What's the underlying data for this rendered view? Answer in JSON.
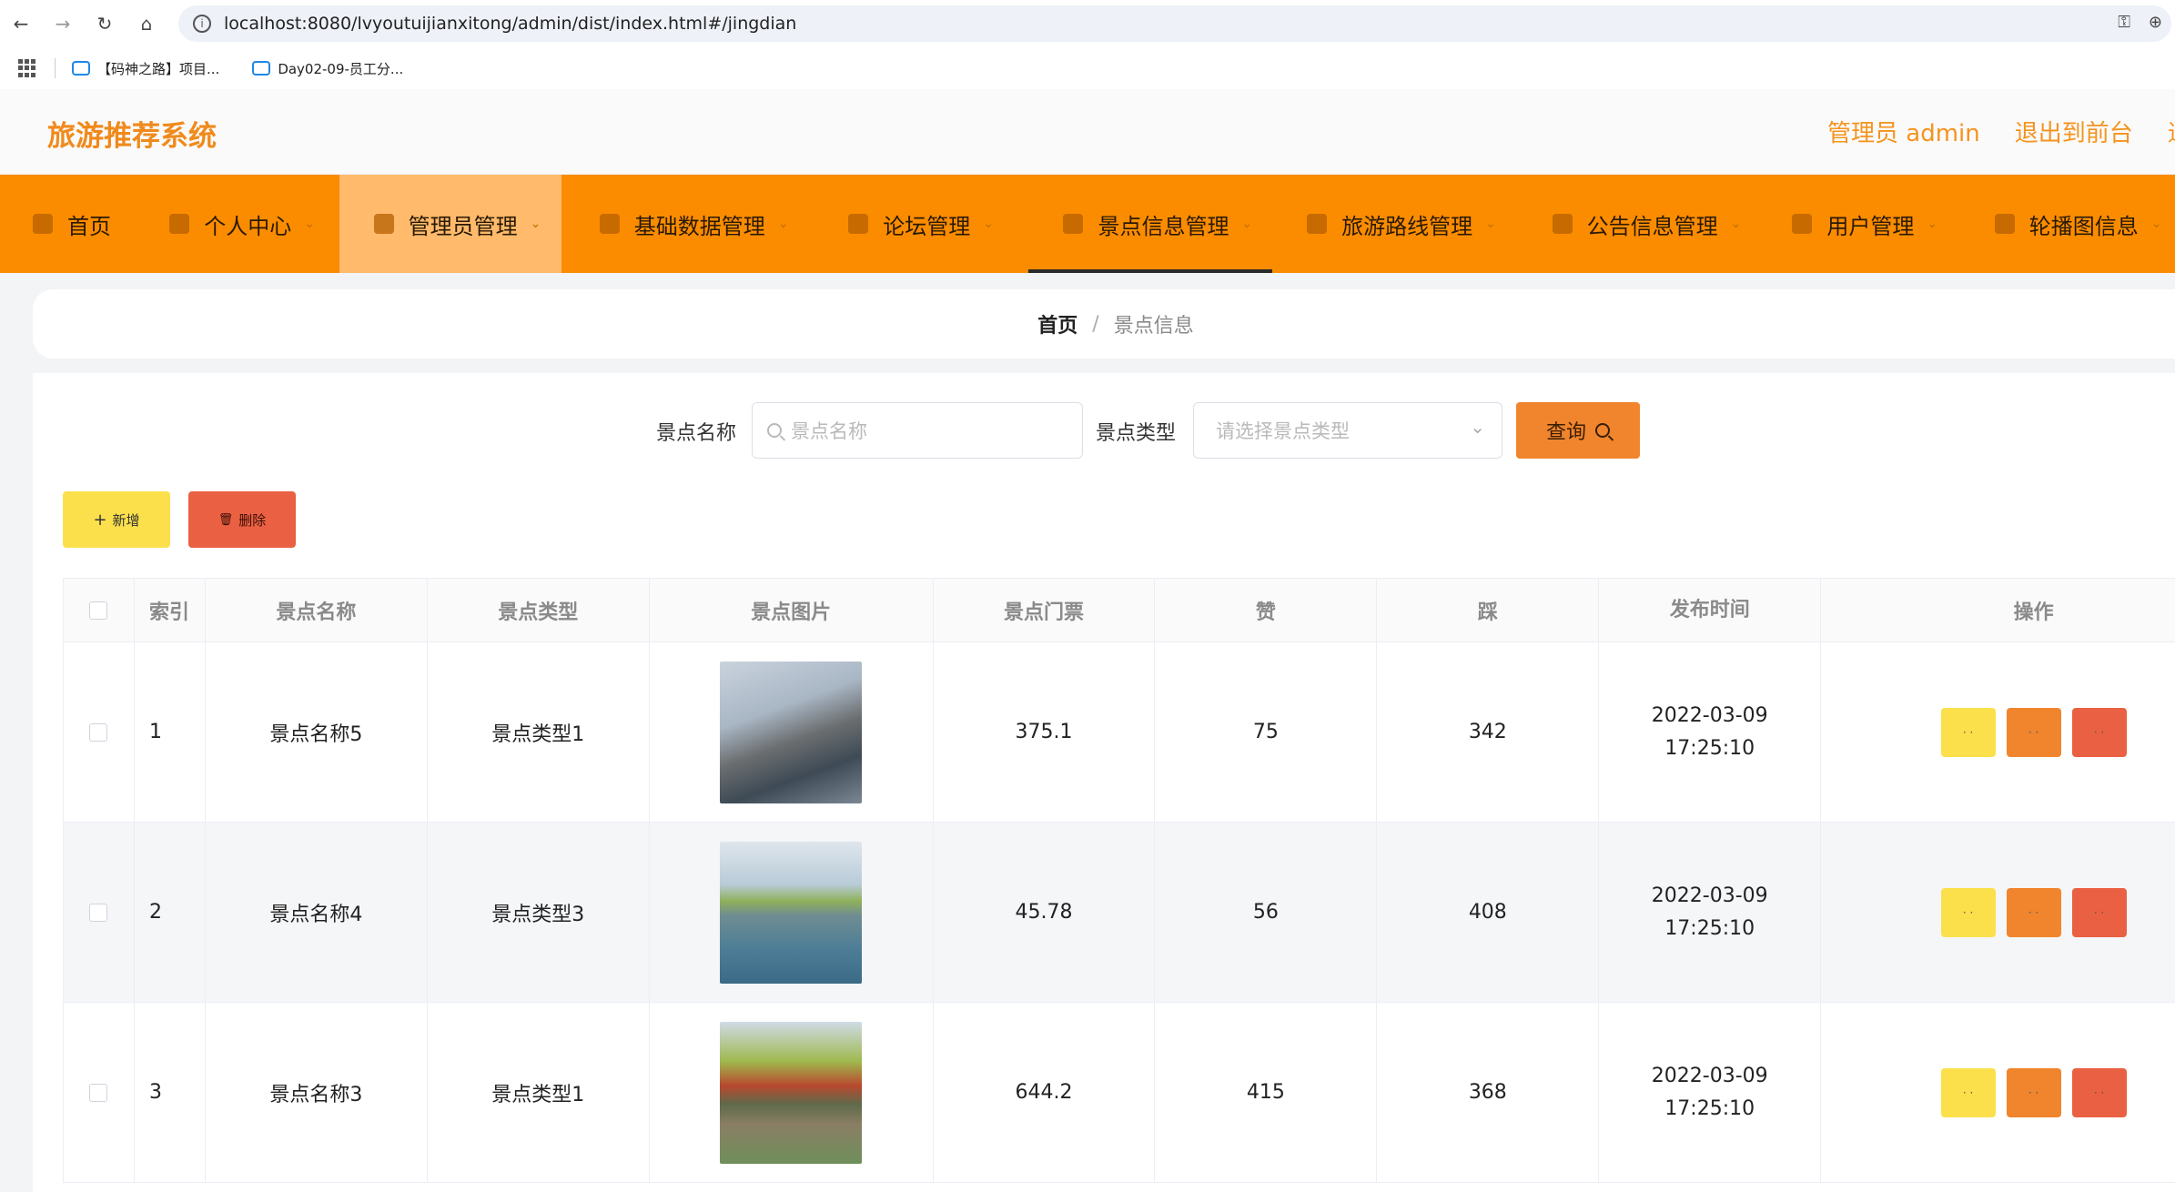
{
  "browser": {
    "url": "localhost:8080/lvyoutuijianxitong/admin/dist/index.html#/jingdian",
    "bookmarks": [
      "【码神之路】项目...",
      "Day02-09-员工分..."
    ]
  },
  "header": {
    "title": "旅游推荐系统",
    "admin_label": "管理员 admin",
    "exit_front": "退出到前台",
    "exit_cut": "退"
  },
  "nav": [
    {
      "label": "首页",
      "has_chev": false
    },
    {
      "label": "个人中心",
      "has_chev": true
    },
    {
      "label": "管理员管理",
      "has_chev": true
    },
    {
      "label": "基础数据管理",
      "has_chev": true
    },
    {
      "label": "论坛管理",
      "has_chev": true
    },
    {
      "label": "景点信息管理",
      "has_chev": true
    },
    {
      "label": "旅游路线管理",
      "has_chev": true
    },
    {
      "label": "公告信息管理",
      "has_chev": true
    },
    {
      "label": "用户管理",
      "has_chev": true
    },
    {
      "label": "轮播图信息",
      "has_chev": true
    }
  ],
  "breadcrumb": {
    "home": "首页",
    "sep": "/",
    "current": "景点信息"
  },
  "search": {
    "name_label": "景点名称",
    "name_placeholder": "景点名称",
    "type_label": "景点类型",
    "type_placeholder": "请选择景点类型",
    "query_label": "查询"
  },
  "actions": {
    "add_label": "新增",
    "delete_label": "删除"
  },
  "table": {
    "headers": {
      "index": "索引",
      "name": "景点名称",
      "type": "景点类型",
      "image": "景点图片",
      "price": "景点门票",
      "zan": "赞",
      "cai": "踩",
      "time": "发布时间",
      "op": "操作"
    },
    "rows": [
      {
        "index": "1",
        "name": "景点名称5",
        "type": "景点类型1",
        "price": "375.1",
        "zan": "75",
        "cai": "342",
        "time": "2022-03-09 17:25:10"
      },
      {
        "index": "2",
        "name": "景点名称4",
        "type": "景点类型3",
        "price": "45.78",
        "zan": "56",
        "cai": "408",
        "time": "2022-03-09 17:25:10"
      },
      {
        "index": "3",
        "name": "景点名称3",
        "type": "景点类型1",
        "price": "644.2",
        "zan": "415",
        "cai": "368",
        "time": "2022-03-09 17:25:10"
      }
    ]
  },
  "colors": {
    "nav_orange": "#fb8c00",
    "title_orange": "#f08a1c",
    "btn_yellow": "#fbe04c",
    "btn_orange": "#f0852d",
    "btn_red": "#ea6042"
  }
}
